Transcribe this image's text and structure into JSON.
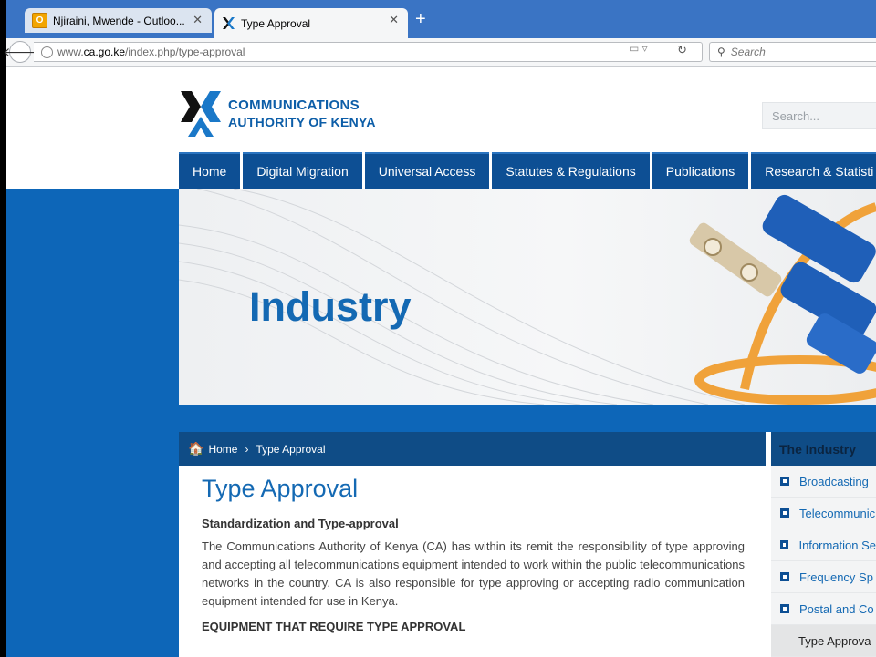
{
  "browser": {
    "tabs": [
      {
        "label": "Njiraini, Mwende - Outloo...",
        "icon": "outlook-icon",
        "active": false
      },
      {
        "label": "Type Approval",
        "icon": "ca-kenya-favicon",
        "active": true
      }
    ],
    "new_tab_label": "+",
    "url_prefix": "www.",
    "url_domain": "ca.go.ke",
    "url_path": "/index.php/type-approval",
    "search_placeholder": "Search"
  },
  "site": {
    "logo_line1": "COMMUNICATIONS",
    "logo_line2": "AUTHORITY OF KENYA",
    "search_placeholder": "Search...",
    "nav": [
      "Home",
      "Digital Migration",
      "Universal Access",
      "Statutes & Regulations",
      "Publications",
      "Research & Statisti"
    ],
    "banner_title": "Industry",
    "breadcrumb": {
      "home": "Home",
      "current": "Type Approval"
    },
    "page_title": "Type Approval",
    "section_heading": "Standardization and Type-approval",
    "paragraph": "The Communications Authority of Kenya (CA) has within its remit the responsibility of type approving and accepting all telecommunications equipment intended to work within the public telecommunications networks in the country.  CA is also responsible for type approving or accepting radio communication equipment intended for use in Kenya.",
    "subheading": "EQUIPMENT THAT REQUIRE TYPE APPROVAL",
    "sidebar": {
      "title": "The Industry",
      "items": [
        "Broadcasting",
        "Telecommunic",
        "Information Se",
        "Frequency Sp",
        "Postal and Co"
      ],
      "active_item": "Type Approva"
    },
    "colors": {
      "brand_blue": "#0d66b8",
      "nav_blue": "#0d4f94",
      "title_blue": "#1469b3"
    }
  }
}
